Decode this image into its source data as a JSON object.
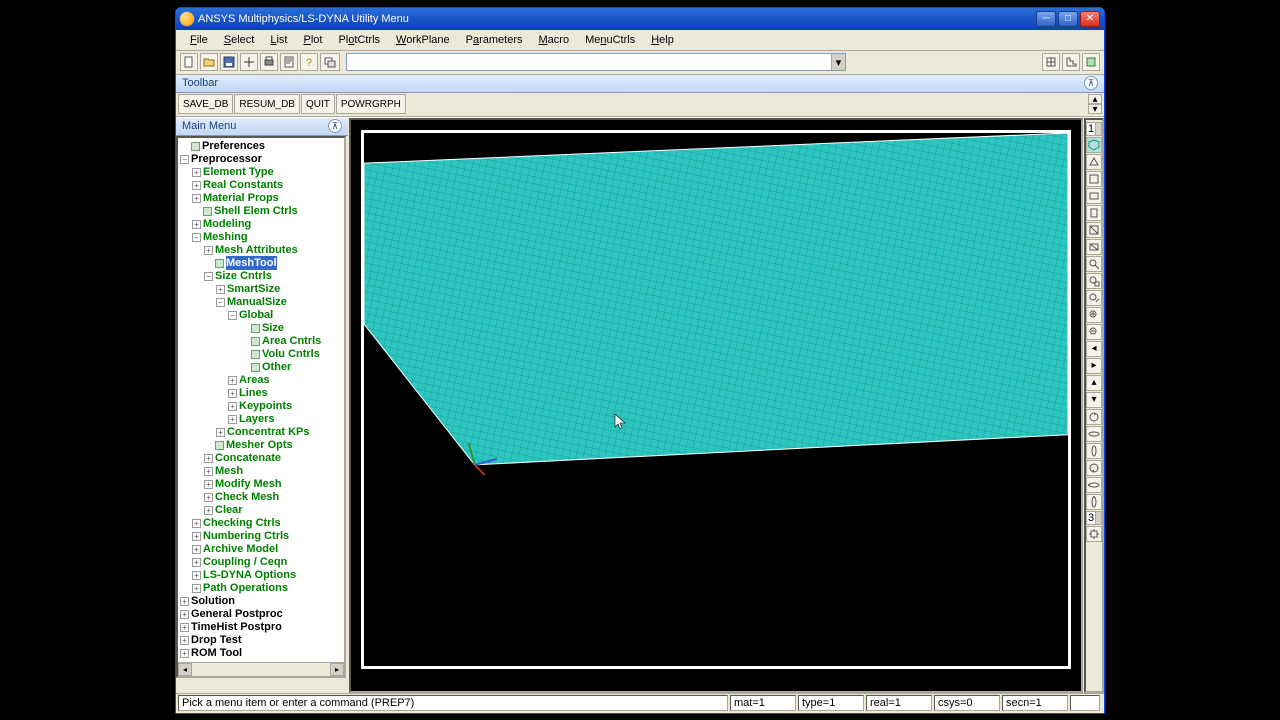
{
  "window": {
    "title": "ANSYS Multiphysics/LS-DYNA Utility Menu"
  },
  "menubar": {
    "file": "File",
    "select": "Select",
    "list": "List",
    "plot": "Plot",
    "plotctrls": "PlotCtrls",
    "workplane": "WorkPlane",
    "parameters": "Parameters",
    "macro": "Macro",
    "menuctrls": "MenuCtrls",
    "help": "Help"
  },
  "toolbar": {
    "label": "Toolbar",
    "btn_save": "SAVE_DB",
    "btn_resum": "RESUM_DB",
    "btn_quit": "QUIT",
    "btn_pow": "POWRGRPH"
  },
  "mainmenu": {
    "label": "Main Menu"
  },
  "tree": {
    "preferences": "Preferences",
    "preprocessor": "Preprocessor",
    "element_type": "Element Type",
    "real_constants": "Real Constants",
    "material_props": "Material Props",
    "shell_elem_ctrls": "Shell Elem Ctrls",
    "modeling": "Modeling",
    "meshing": "Meshing",
    "mesh_attributes": "Mesh Attributes",
    "meshtool": "MeshTool",
    "size_cntrls": "Size Cntrls",
    "smartsize": "SmartSize",
    "manualsize": "ManualSize",
    "global": "Global",
    "size": "Size",
    "area_cntrls": "Area Cntrls",
    "volu_cntrls": "Volu Cntrls",
    "other": "Other",
    "areas": "Areas",
    "lines": "Lines",
    "keypoints": "Keypoints",
    "layers": "Layers",
    "concentrat_kps": "Concentrat KPs",
    "mesher_opts": "Mesher Opts",
    "concatenate": "Concatenate",
    "mesh": "Mesh",
    "modify_mesh": "Modify Mesh",
    "check_mesh": "Check Mesh",
    "clear": "Clear",
    "checking_ctrls": "Checking Ctrls",
    "numbering_ctrls": "Numbering Ctrls",
    "archive_model": "Archive Model",
    "coupling_ceqn": "Coupling / Ceqn",
    "lsdyna_options": "LS-DYNA Options",
    "path_operations": "Path Operations",
    "solution": "Solution",
    "general_postproc": "General Postproc",
    "timehist_postpro": "TimeHist Postpro",
    "drop_test": "Drop Test",
    "rom_tool": "ROM Tool"
  },
  "rtoolbar": {
    "win": "1",
    "level": "3"
  },
  "status": {
    "prompt": "Pick a menu item or enter a command (PREP7)",
    "mat": "mat=1",
    "type": "type=1",
    "real": "real=1",
    "csys": "csys=0",
    "secn": "secn=1"
  },
  "colors": {
    "mesh": "#2cc6c0",
    "mesh_edge": "#1a8e89",
    "triad_y": "#2e9a2e",
    "triad_x": "#2e5fd6"
  }
}
